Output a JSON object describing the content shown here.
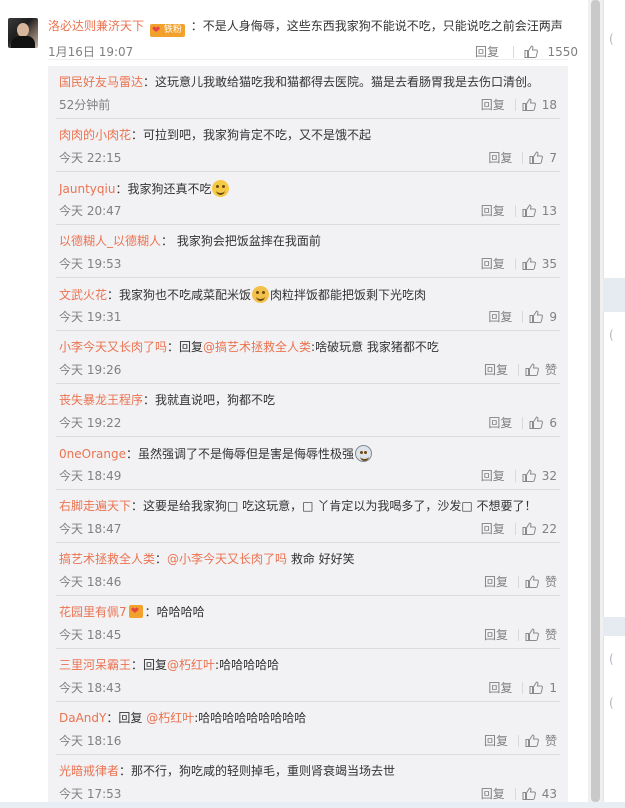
{
  "top_comment": {
    "username": "洛必达则兼济天下",
    "fan_badge": "铁粉",
    "text": "：不是人身侮辱，这些东西我家狗不能说不吃，只能说吃之前会汪两声",
    "time": "1月16日 19:07",
    "reply_label": "回复",
    "likes": "1550"
  },
  "replies": [
    {
      "user": "国民好友马雷达",
      "text": "：这玩意儿我敢给猫吃我和猫都得去医院。猫是去看肠胃我是去伤口清创。",
      "time": "52分钟前",
      "likes": "18"
    },
    {
      "user": "肉肉的小肉花",
      "text": "：可拉到吧，我家狗肯定不吃，又不是饿不起",
      "time": "今天 22:15",
      "likes": "7"
    },
    {
      "user": "Jauntyqiu",
      "text": "：我家狗还真不吃",
      "time": "今天 20:47",
      "likes": "13"
    },
    {
      "user": "以德糊人_以德糊人",
      "text": "： 我家狗会把饭盆摔在我面前",
      "time": "今天 19:53",
      "likes": "35"
    },
    {
      "user": "文武火花",
      "text": "：我家狗也不吃咸菜配米饭",
      "text2": "肉粒拌饭都能把饭剩下光吃肉",
      "time": "今天 19:31",
      "likes": "9"
    },
    {
      "user": "小李今天又长肉了吗",
      "text": "：回复",
      "mention": "@搞艺术拯救全人类",
      "text2": ":啥破玩意 我家猪都不吃",
      "time": "今天 19:26",
      "likes": "赞"
    },
    {
      "user": "丧失暴龙王程序",
      "text": "：我就直说吧，狗都不吃",
      "time": "今天 19:22",
      "likes": "6"
    },
    {
      "user": "0neOrange",
      "text": "：虽然强调了不是侮辱但是害是侮辱性极强",
      "time": "今天 18:49",
      "likes": "32"
    },
    {
      "user": "右脚走遍天下",
      "text": "：这要是给我家狗□ 吃这玩意，□ 丫肯定以为我喝多了，沙发□ 不想要了！",
      "time": "今天 18:47",
      "likes": "22"
    },
    {
      "user": "搞艺术拯救全人类",
      "text": "：",
      "mention": "@小李今天又长肉了吗",
      "text2": " 救命 好好笑",
      "time": "今天 18:46",
      "likes": "赞"
    },
    {
      "user": "花园里有佩7",
      "text": "：哈哈哈哈",
      "time": "今天 18:45",
      "likes": "赞"
    },
    {
      "user": "三里河呆霸王",
      "text": "：回复",
      "mention": "@朽红叶",
      "text2": ":哈哈哈哈哈",
      "time": "今天 18:43",
      "likes": "1"
    },
    {
      "user": "DaAndY",
      "text": "：回复 ",
      "mention": "@朽红叶",
      "text2": ":哈哈哈哈哈哈哈哈哈",
      "time": "今天 18:16",
      "likes": "赞"
    },
    {
      "user": "光暗戒律者",
      "text": "：那不行，狗吃咸的轻则掉毛，重则肾衰竭当场去世",
      "time": "今天 17:53",
      "likes": "43"
    }
  ],
  "reply_label": "回复",
  "side_glyphs": [
    "(",
    "(",
    "(",
    "("
  ]
}
